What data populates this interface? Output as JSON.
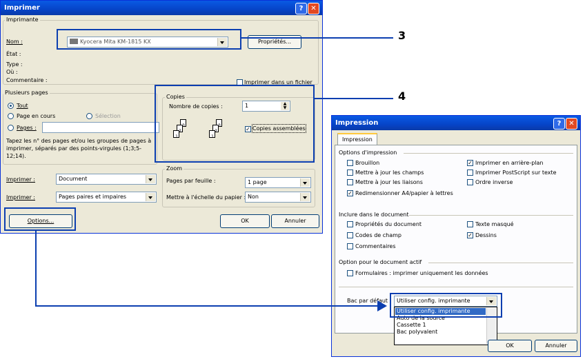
{
  "print_dialog": {
    "title": "Imprimer",
    "printer_group": "Imprimante",
    "name_label": "Nom :",
    "printer_name": "Kyocera Mita KM-1815 KX",
    "properties_button": "Propriétés...",
    "status_label": "État :",
    "type_label": "Type :",
    "where_label": "Où :",
    "comment_label": "Commentaire :",
    "print_to_file": "Imprimer dans un fichier",
    "pages_group": "Plusieurs pages",
    "all": "Tout",
    "current_page": "Page en cours",
    "selection": "Sélection",
    "pages_label": "Pages :",
    "pages_hint": "Tapez les n° des pages et/ou les groupes de pages à imprimer, séparés par des points-virgules (1;3;5-12;14).",
    "copies_group": "Copies",
    "copies_label": "Nombre de copies :",
    "copies_value": "1",
    "collate": "Copies assemblées",
    "print_what_label": "Imprimer :",
    "print_what_value": "Document",
    "print_label": "Imprimer :",
    "print_value": "Pages paires et impaires",
    "zoom_group": "Zoom",
    "pages_per_sheet_label": "Pages par feuille :",
    "pages_per_sheet_value": "1 page",
    "scale_label": "Mettre à l'échelle du papier :",
    "scale_value": "Non",
    "options_button": "Options...",
    "ok_button": "OK",
    "cancel_button": "Annuler"
  },
  "impression_dialog": {
    "title": "Impression",
    "tab": "Impression",
    "print_options_group": "Options d'impression",
    "draft": "Brouillon",
    "update_fields": "Mettre à jour les champs",
    "update_links": "Mettre à jour les liaisons",
    "resize": "Redimensionner A4/papier à lettres",
    "background": "Imprimer en arrière-plan",
    "postscript": "Imprimer PostScript sur texte",
    "reverse": "Ordre inverse",
    "include_group": "Inclure dans le document",
    "doc_properties": "Propriétés du document",
    "field_codes": "Codes de champ",
    "comments": "Commentaires",
    "hidden_text": "Texte masqué",
    "drawings": "Dessins",
    "active_doc_group": "Option pour le document actif",
    "forms_only": "Formulaires : imprimer uniquement les données",
    "default_tray_label": "Bac par défaut :",
    "tray_selected": "Utiliser config. imprimante",
    "tray_options": [
      "Utiliser config. imprimante",
      "Auto de la source",
      "Cassette 1",
      "Bac polyvalent"
    ],
    "ok_button": "OK",
    "cancel_button": "Annuler"
  },
  "callouts": {
    "three": "3",
    "four": "4"
  }
}
